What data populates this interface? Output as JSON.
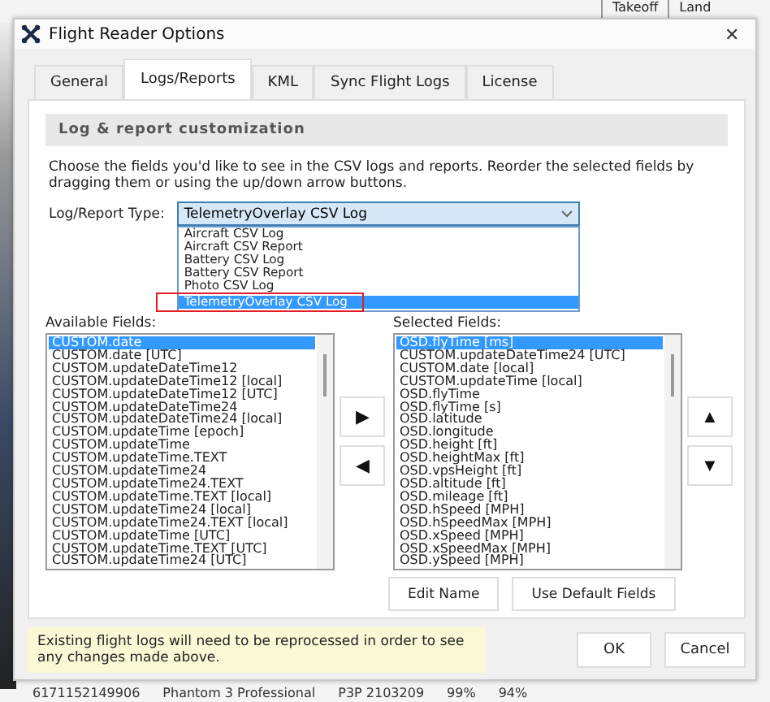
{
  "background_app": {
    "header_cells": [
      "Takeoff",
      "Land"
    ],
    "bottom_row": [
      "6171152149906",
      "Phantom 3 Professional",
      "P3P 2103209",
      "99%",
      "94%"
    ]
  },
  "window": {
    "title": "Flight Reader Options",
    "close": "✕"
  },
  "tabs": [
    {
      "label": "General",
      "selected": false
    },
    {
      "label": "Logs/Reports",
      "selected": true
    },
    {
      "label": "KML",
      "selected": false
    },
    {
      "label": "Sync Flight Logs",
      "selected": false
    },
    {
      "label": "License",
      "selected": false
    }
  ],
  "section_title": "Log & report customization",
  "description": "Choose the fields you'd like to see in the CSV logs and reports. Reorder the selected fields by dragging them or using the up/down arrow buttons.",
  "log_type": {
    "label": "Log/Report Type:",
    "value": "TelemetryOverlay CSV Log",
    "expanded": true,
    "options": [
      {
        "label": "Aircraft CSV Log",
        "selected": false,
        "highlighted": false
      },
      {
        "label": "Aircraft CSV Report",
        "selected": false,
        "highlighted": false
      },
      {
        "label": "Battery CSV Log",
        "selected": false,
        "highlighted": false
      },
      {
        "label": "Battery CSV Report",
        "selected": false,
        "highlighted": false
      },
      {
        "label": "Photo CSV Log",
        "selected": false,
        "highlighted": false
      },
      {
        "label": "TelemetryOverlay CSV Log",
        "selected": true,
        "highlighted": true
      }
    ]
  },
  "available_fields": {
    "label": "Available Fields:",
    "items": [
      {
        "label": "CUSTOM.date",
        "selected": true
      },
      {
        "label": "CUSTOM.date [UTC]",
        "selected": false
      },
      {
        "label": "CUSTOM.updateDateTime12",
        "selected": false
      },
      {
        "label": "CUSTOM.updateDateTime12 [local]",
        "selected": false
      },
      {
        "label": "CUSTOM.updateDateTime12 [UTC]",
        "selected": false
      },
      {
        "label": "CUSTOM.updateDateTime24",
        "selected": false
      },
      {
        "label": "CUSTOM.updateDateTime24 [local]",
        "selected": false
      },
      {
        "label": "CUSTOM.updateTime [epoch]",
        "selected": false
      },
      {
        "label": "CUSTOM.updateTime",
        "selected": false
      },
      {
        "label": "CUSTOM.updateTime.TEXT",
        "selected": false
      },
      {
        "label": "CUSTOM.updateTime24",
        "selected": false
      },
      {
        "label": "CUSTOM.updateTime24.TEXT",
        "selected": false
      },
      {
        "label": "CUSTOM.updateTime.TEXT [local]",
        "selected": false
      },
      {
        "label": "CUSTOM.updateTime24 [local]",
        "selected": false
      },
      {
        "label": "CUSTOM.updateTime24.TEXT [local]",
        "selected": false
      },
      {
        "label": "CUSTOM.updateTime [UTC]",
        "selected": false
      },
      {
        "label": "CUSTOM.updateTime.TEXT [UTC]",
        "selected": false
      },
      {
        "label": "CUSTOM.updateTime24 [UTC]",
        "selected": false
      }
    ]
  },
  "transfer_buttons": [
    "▶",
    "◀"
  ],
  "selected_fields": {
    "label": "Selected Fields:",
    "items": [
      {
        "label": "OSD.flyTime [ms]",
        "selected": true
      },
      {
        "label": "CUSTOM.updateDateTime24 [UTC]",
        "selected": false
      },
      {
        "label": "CUSTOM.date [local]",
        "selected": false
      },
      {
        "label": "CUSTOM.updateTime [local]",
        "selected": false
      },
      {
        "label": "OSD.flyTime",
        "selected": false
      },
      {
        "label": "OSD.flyTime [s]",
        "selected": false
      },
      {
        "label": "OSD.latitude",
        "selected": false
      },
      {
        "label": "OSD.longitude",
        "selected": false
      },
      {
        "label": "OSD.height [ft]",
        "selected": false
      },
      {
        "label": "OSD.heightMax [ft]",
        "selected": false
      },
      {
        "label": "OSD.vpsHeight [ft]",
        "selected": false
      },
      {
        "label": "OSD.altitude [ft]",
        "selected": false
      },
      {
        "label": "OSD.mileage [ft]",
        "selected": false
      },
      {
        "label": "OSD.hSpeed [MPH]",
        "selected": false
      },
      {
        "label": "OSD.hSpeedMax [MPH]",
        "selected": false
      },
      {
        "label": "OSD.xSpeed [MPH]",
        "selected": false
      },
      {
        "label": "OSD.xSpeedMax [MPH]",
        "selected": false
      },
      {
        "label": "OSD.ySpeed [MPH]",
        "selected": false
      }
    ]
  },
  "order_buttons": [
    "▲",
    "▼"
  ],
  "field_buttons": [
    "Edit Name",
    "Use Default Fields"
  ],
  "notice": "Existing flight logs will need to be reprocessed in order to see any changes made above.",
  "dialog_buttons": [
    "OK",
    "Cancel"
  ]
}
